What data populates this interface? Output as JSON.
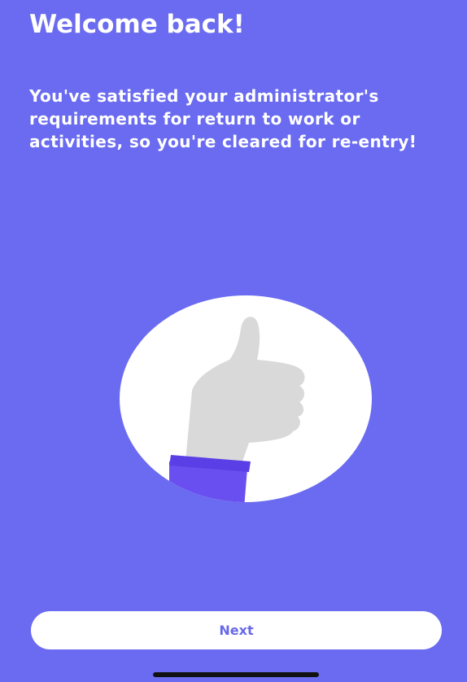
{
  "header": {
    "title": "Welcome back!"
  },
  "body": {
    "message": "You've satisfied your administrator's requirements for return to work or activities, so you're cleared for re-entry!"
  },
  "illustration": {
    "icon": "thumbs-up-icon"
  },
  "footer": {
    "next_label": "Next"
  },
  "colors": {
    "background": "#6a6bf0",
    "button_text": "#6869e8",
    "cuff": "#6a4ff0",
    "hand": "#d9d9d9"
  }
}
